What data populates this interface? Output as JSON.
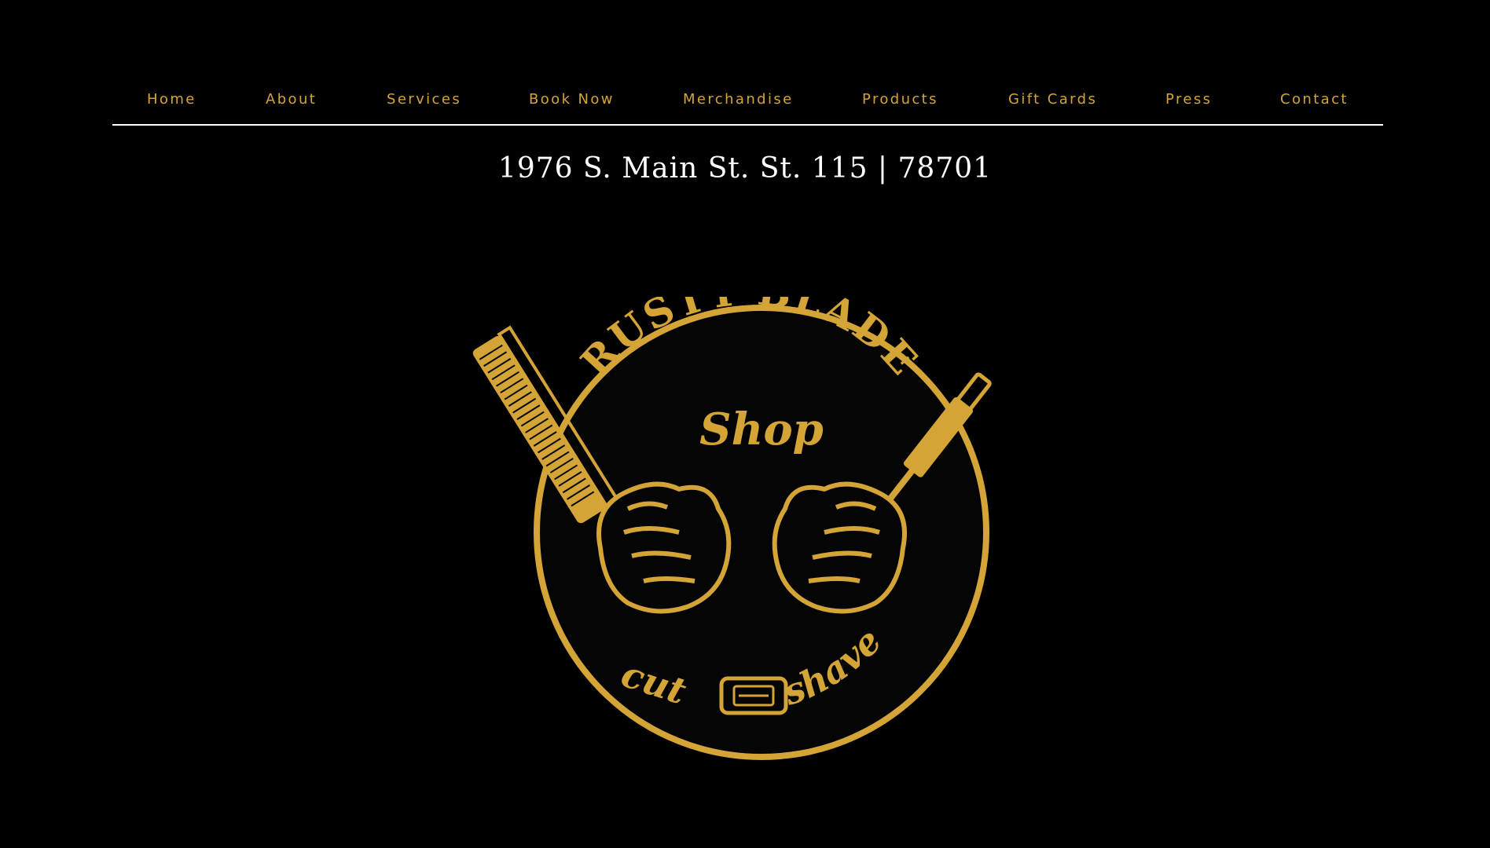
{
  "nav": {
    "items": [
      {
        "label": "Home"
      },
      {
        "label": "About"
      },
      {
        "label": "Services"
      },
      {
        "label": "Book Now"
      },
      {
        "label": "Merchandise"
      },
      {
        "label": "Products"
      },
      {
        "label": "Gift Cards"
      },
      {
        "label": "Press"
      },
      {
        "label": "Contact"
      }
    ]
  },
  "address": "1976 S. Main St. St. 115 | 78701",
  "logo": {
    "top_text": "RUSTY BLADE",
    "script_text": "Shop",
    "left_text": "cut",
    "right_text": "shave",
    "icon_left": "comb-icon",
    "icon_right": "straight-razor-icon",
    "icon_center": "razor-blade-icon"
  },
  "colors": {
    "background": "#000000",
    "accent_gold": "#d4a437",
    "address_text": "#ffffff",
    "divider": "#ffffff"
  }
}
